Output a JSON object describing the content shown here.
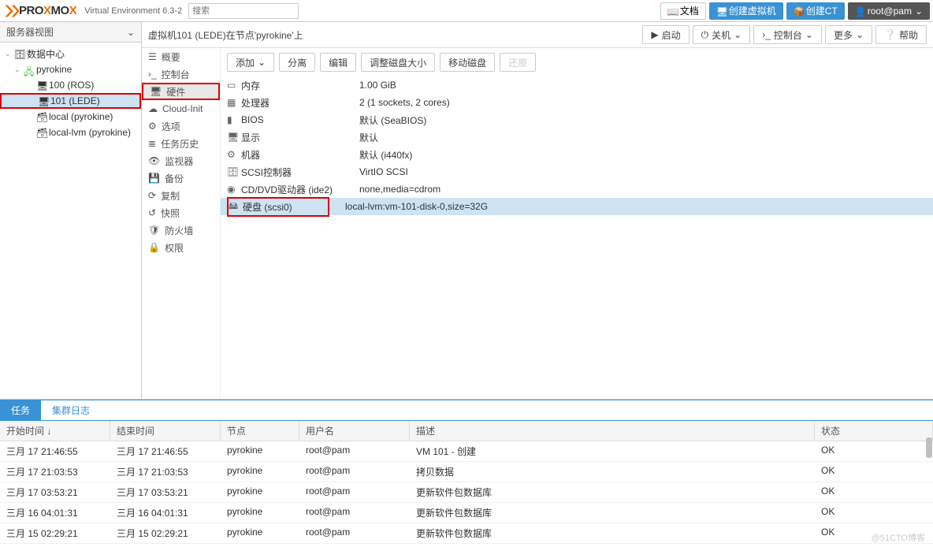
{
  "header": {
    "product": "PROXMOX",
    "version_label": "Virtual Environment 6.3-2",
    "search_placeholder": "搜索",
    "doc": "文档",
    "create_vm": "创建虚拟机",
    "create_ct": "创建CT",
    "user": "root@pam"
  },
  "left": {
    "view": "服务器视图",
    "dc": "数据中心",
    "node": "pyrokine",
    "vm100": "100 (ROS)",
    "vm101": "101 (LEDE)",
    "local": "local (pyrokine)",
    "localvm": "local-lvm (pyrokine)"
  },
  "breadcrumb": "虚拟机101 (LEDE)在节点'pyrokine'上",
  "actions": {
    "start": "启动",
    "shutdown": "关机",
    "console": "控制台",
    "more": "更多",
    "help": "帮助"
  },
  "sidemenu": {
    "summary": "概要",
    "console": "控制台",
    "hardware": "硬件",
    "cloudinit": "Cloud-Init",
    "options": "选项",
    "taskhist": "任务历史",
    "monitor": "监视器",
    "backup": "备份",
    "replication": "复制",
    "snapshot": "快照",
    "firewall": "防火墙",
    "permissions": "权限"
  },
  "toolbar": {
    "add": "添加",
    "detach": "分离",
    "edit": "编辑",
    "resize": "调整磁盘大小",
    "move": "移动磁盘",
    "revert": "还原"
  },
  "hardware": [
    {
      "name": "内存",
      "val": "1.00 GiB"
    },
    {
      "name": "处理器",
      "val": "2 (1 sockets, 2 cores)"
    },
    {
      "name": "BIOS",
      "val": "默认 (SeaBIOS)"
    },
    {
      "name": "显示",
      "val": "默认"
    },
    {
      "name": "机器",
      "val": "默认 (i440fx)"
    },
    {
      "name": "SCSI控制器",
      "val": "VirtIO SCSI"
    },
    {
      "name": "CD/DVD驱动器 (ide2)",
      "val": "none,media=cdrom"
    },
    {
      "name": "硬盘 (scsi0)",
      "val": "local-lvm:vm-101-disk-0,size=32G"
    }
  ],
  "bottom": {
    "tasks": "任务",
    "cluster": "集群日志",
    "cols": {
      "start": "开始时间 ↓",
      "end": "结束时间",
      "node": "节点",
      "user": "用户名",
      "desc": "描述",
      "status": "状态"
    },
    "rows": [
      {
        "start": "三月 17 21:46:55",
        "end": "三月 17 21:46:55",
        "node": "pyrokine",
        "user": "root@pam",
        "desc": "VM 101 - 创建",
        "status": "OK"
      },
      {
        "start": "三月 17 21:03:53",
        "end": "三月 17 21:03:53",
        "node": "pyrokine",
        "user": "root@pam",
        "desc": "拷贝数据",
        "status": "OK"
      },
      {
        "start": "三月 17 03:53:21",
        "end": "三月 17 03:53:21",
        "node": "pyrokine",
        "user": "root@pam",
        "desc": "更新软件包数据库",
        "status": "OK"
      },
      {
        "start": "三月 16 04:01:31",
        "end": "三月 16 04:01:31",
        "node": "pyrokine",
        "user": "root@pam",
        "desc": "更新软件包数据库",
        "status": "OK"
      },
      {
        "start": "三月 15 02:29:21",
        "end": "三月 15 02:29:21",
        "node": "pyrokine",
        "user": "root@pam",
        "desc": "更新软件包数据库",
        "status": "OK"
      }
    ]
  },
  "watermark": "@51CTO博客"
}
